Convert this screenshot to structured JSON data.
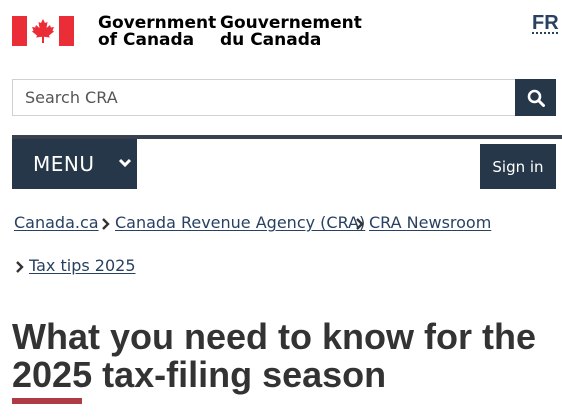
{
  "header": {
    "signature_en_line1": "Government",
    "signature_en_line2": "of Canada",
    "signature_fr_line1": "Gouvernement",
    "signature_fr_line2": "du Canada",
    "language_toggle": "FR",
    "flag_color": "#eb2d37"
  },
  "search": {
    "placeholder": "Search CRA",
    "button_icon": "search-icon"
  },
  "nav": {
    "menu_label": "MENU",
    "sign_in_label": "Sign in",
    "accent_color": "#26374a"
  },
  "breadcrumb": {
    "items": [
      {
        "label": "Canada.ca"
      },
      {
        "label": "Canada Revenue Agency (CRA)"
      },
      {
        "label": "CRA Newsroom"
      },
      {
        "label": "Tax tips 2025"
      }
    ]
  },
  "page": {
    "title": "What you need to know for the 2025 tax-filing season",
    "title_rule_color": "#af3c43"
  }
}
